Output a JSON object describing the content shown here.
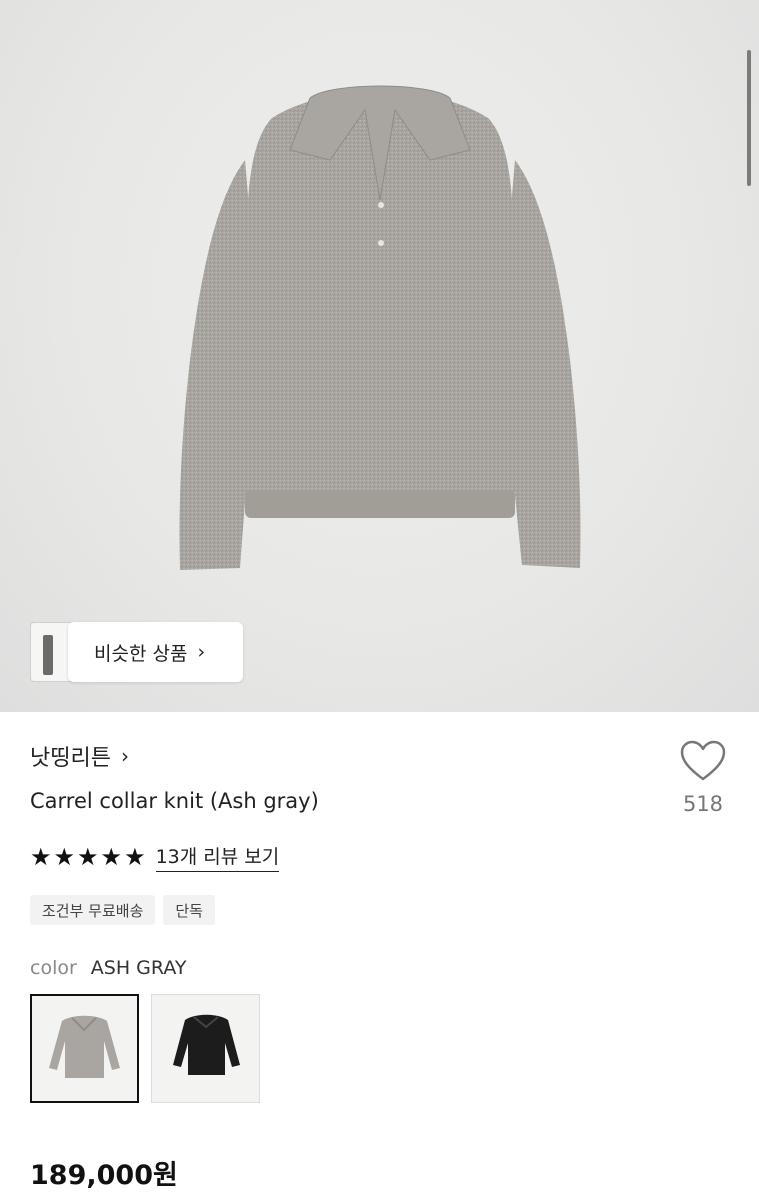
{
  "hero": {
    "similar_button_label": "비슷한 상품"
  },
  "product": {
    "brand": "낫띵리튼",
    "title": "Carrel collar knit (Ash gray)",
    "likes": "518",
    "rating_stars": 5,
    "review_link": "13개 리뷰 보기",
    "tags": [
      "조건부 무료배송",
      "단독"
    ],
    "color_label": "color",
    "color_value": "ASH GRAY",
    "price": "189,000원"
  },
  "colors": {
    "selected_swatch": "#a9a6a1",
    "alt_swatch": "#1c1c1c"
  }
}
